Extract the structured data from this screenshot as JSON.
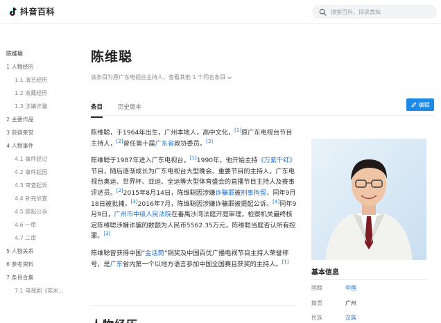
{
  "header": {
    "logo_text": "抖音百科",
    "search_placeholder": "搜索百科，探求真知",
    "icons": [
      "douyin-logo-icon",
      "search-icon"
    ]
  },
  "toc": {
    "items": [
      {
        "label": "陈维聪",
        "level": 0
      },
      {
        "label": "1 人物经历",
        "level": 1
      },
      {
        "label": "1.1 演艺经历",
        "level": 2
      },
      {
        "label": "1.2 收藏经历",
        "level": 2
      },
      {
        "label": "1.3 涉嫌诈骗",
        "level": 2
      },
      {
        "label": "2 主要作品",
        "level": 1
      },
      {
        "label": "3 获得荣誉",
        "level": 1
      },
      {
        "label": "4 人物事件",
        "level": 1
      },
      {
        "label": "4.1 事件经过",
        "level": 2
      },
      {
        "label": "4.2 事件起因",
        "level": 2
      },
      {
        "label": "4.3 审查起诉",
        "level": 2
      },
      {
        "label": "4.4 补充侦查",
        "level": 2
      },
      {
        "label": "4.5 提起公诉",
        "level": 2
      },
      {
        "label": "4.6 一审",
        "level": 2
      },
      {
        "label": "4.7 二审",
        "level": 2
      },
      {
        "label": "5 人物关系",
        "level": 1
      },
      {
        "label": "6 参考资料",
        "level": 1
      },
      {
        "label": "7 条目合集",
        "level": 1
      },
      {
        "label": "7.1 电视剧《奕米...",
        "level": 2
      }
    ]
  },
  "article": {
    "title": "陈维聪",
    "subnote": "该条目为原广东电视台主持人，查看其他 1 个同名条目",
    "tabs": [
      "条目",
      "历史版本"
    ],
    "active_tab": "条目",
    "edit_label": "编辑",
    "paragraphs": {
      "p1_a": "陈维聪，于1964年出生，广州本地人，高中文化，",
      "p1_r1": "[1]",
      "p1_b": "原广东电视台节目主持人，",
      "p1_r2": "[2]",
      "p1_c": "曾任第十届",
      "p1_link1": "广东省",
      "p1_d": "政协委员。",
      "p1_r3": "[3]",
      "p2_a": "陈维聪于1987年进入广东电视台，",
      "p2_r1": "[1]",
      "p2_b": "1990年，他开始主持",
      "p2_link1": "《万紫千红》",
      "p2_c": "节目，随后逐渐成长为广东电视台大型晚会、重要节目的主持人，广东电视台奥运、世界杯、亚运、全运等大型体育盛会的直播节目主持人及赛事评述员。",
      "p2_r2": "[2]",
      "p2_d": "2015年8月14日，陈维聪因涉嫌",
      "p2_link2": "诈骗罪",
      "p2_e": "被",
      "p2_link3": "刑事拘留",
      "p2_f": "，同年9月18日被批捕。",
      "p2_r3": "[3]",
      "p2_g": "2016年7月，陈维聪因涉嫌诈骗罪被提起公诉。",
      "p2_r4": "[4]",
      "p2_h": "同年9月9日，",
      "p2_link4": "广州市中级人民法院",
      "p2_i": "在番禺沙湾法庭开庭审理，检察机关最终核定陈维聪涉嫌诈骗的数额为人民币5562.35万元，陈维聪当庭否认所有控罪。",
      "p2_r5": "[3]",
      "p3_a": "陈维聪曾获得中国“",
      "p3_link1": "金话筒",
      "p3_b": "”铜奖及中国百优广播电视节目主持人荣誉称号，是",
      "p3_link2": "广东",
      "p3_c": "省内第一个以地方语言参加中国全国赛且获奖的主持人。",
      "p3_r1": "[1]"
    },
    "next_section": "人物经历"
  },
  "infobox": {
    "title": "基本信息",
    "rows": [
      {
        "label": "国籍",
        "value": "中国",
        "link": true
      },
      {
        "label": "籍贯",
        "value": "广州",
        "link": false
      },
      {
        "label": "民族",
        "value": "汉族",
        "link": true
      }
    ]
  },
  "colors": {
    "accent": "#1b8ae8",
    "link": "#1b6fce"
  }
}
